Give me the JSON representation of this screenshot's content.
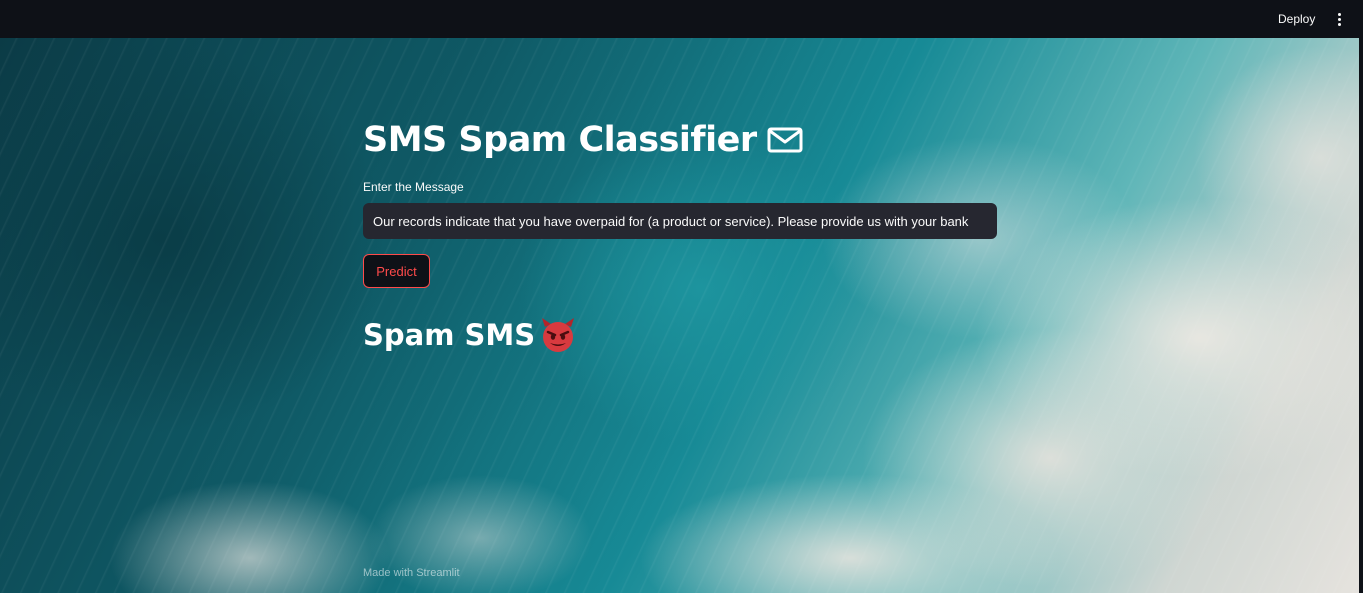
{
  "header": {
    "deploy_label": "Deploy",
    "menu_icon": "more-vertical-icon"
  },
  "main": {
    "title": "SMS Spam Classifier",
    "title_icon": "envelope-icon",
    "input_label": "Enter the Message",
    "input_value": "Our records indicate that you have overpaid for (a product or service). Please provide us with your bank",
    "predict_label": "Predict",
    "result_text": "Spam SMS",
    "result_icon": "smiling-devil-icon"
  },
  "footer": {
    "text": "Made with Streamlit"
  },
  "colors": {
    "header_bg": "#0e1117",
    "input_bg": "#262730",
    "accent": "#ff4b4b",
    "text": "#ffffff"
  }
}
